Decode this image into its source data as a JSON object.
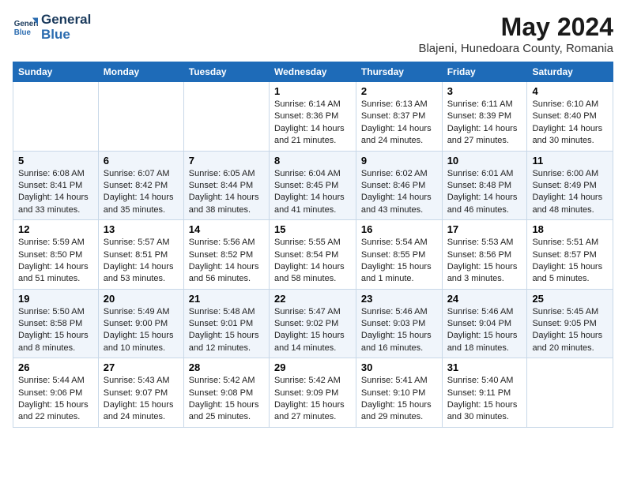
{
  "logo": {
    "line1": "General",
    "line2": "Blue"
  },
  "title": "May 2024",
  "location": "Blajeni, Hunedoara County, Romania",
  "header_days": [
    "Sunday",
    "Monday",
    "Tuesday",
    "Wednesday",
    "Thursday",
    "Friday",
    "Saturday"
  ],
  "weeks": [
    [
      {
        "num": "",
        "info": ""
      },
      {
        "num": "",
        "info": ""
      },
      {
        "num": "",
        "info": ""
      },
      {
        "num": "1",
        "info": "Sunrise: 6:14 AM\nSunset: 8:36 PM\nDaylight: 14 hours and 21 minutes."
      },
      {
        "num": "2",
        "info": "Sunrise: 6:13 AM\nSunset: 8:37 PM\nDaylight: 14 hours and 24 minutes."
      },
      {
        "num": "3",
        "info": "Sunrise: 6:11 AM\nSunset: 8:39 PM\nDaylight: 14 hours and 27 minutes."
      },
      {
        "num": "4",
        "info": "Sunrise: 6:10 AM\nSunset: 8:40 PM\nDaylight: 14 hours and 30 minutes."
      }
    ],
    [
      {
        "num": "5",
        "info": "Sunrise: 6:08 AM\nSunset: 8:41 PM\nDaylight: 14 hours and 33 minutes."
      },
      {
        "num": "6",
        "info": "Sunrise: 6:07 AM\nSunset: 8:42 PM\nDaylight: 14 hours and 35 minutes."
      },
      {
        "num": "7",
        "info": "Sunrise: 6:05 AM\nSunset: 8:44 PM\nDaylight: 14 hours and 38 minutes."
      },
      {
        "num": "8",
        "info": "Sunrise: 6:04 AM\nSunset: 8:45 PM\nDaylight: 14 hours and 41 minutes."
      },
      {
        "num": "9",
        "info": "Sunrise: 6:02 AM\nSunset: 8:46 PM\nDaylight: 14 hours and 43 minutes."
      },
      {
        "num": "10",
        "info": "Sunrise: 6:01 AM\nSunset: 8:48 PM\nDaylight: 14 hours and 46 minutes."
      },
      {
        "num": "11",
        "info": "Sunrise: 6:00 AM\nSunset: 8:49 PM\nDaylight: 14 hours and 48 minutes."
      }
    ],
    [
      {
        "num": "12",
        "info": "Sunrise: 5:59 AM\nSunset: 8:50 PM\nDaylight: 14 hours and 51 minutes."
      },
      {
        "num": "13",
        "info": "Sunrise: 5:57 AM\nSunset: 8:51 PM\nDaylight: 14 hours and 53 minutes."
      },
      {
        "num": "14",
        "info": "Sunrise: 5:56 AM\nSunset: 8:52 PM\nDaylight: 14 hours and 56 minutes."
      },
      {
        "num": "15",
        "info": "Sunrise: 5:55 AM\nSunset: 8:54 PM\nDaylight: 14 hours and 58 minutes."
      },
      {
        "num": "16",
        "info": "Sunrise: 5:54 AM\nSunset: 8:55 PM\nDaylight: 15 hours and 1 minute."
      },
      {
        "num": "17",
        "info": "Sunrise: 5:53 AM\nSunset: 8:56 PM\nDaylight: 15 hours and 3 minutes."
      },
      {
        "num": "18",
        "info": "Sunrise: 5:51 AM\nSunset: 8:57 PM\nDaylight: 15 hours and 5 minutes."
      }
    ],
    [
      {
        "num": "19",
        "info": "Sunrise: 5:50 AM\nSunset: 8:58 PM\nDaylight: 15 hours and 8 minutes."
      },
      {
        "num": "20",
        "info": "Sunrise: 5:49 AM\nSunset: 9:00 PM\nDaylight: 15 hours and 10 minutes."
      },
      {
        "num": "21",
        "info": "Sunrise: 5:48 AM\nSunset: 9:01 PM\nDaylight: 15 hours and 12 minutes."
      },
      {
        "num": "22",
        "info": "Sunrise: 5:47 AM\nSunset: 9:02 PM\nDaylight: 15 hours and 14 minutes."
      },
      {
        "num": "23",
        "info": "Sunrise: 5:46 AM\nSunset: 9:03 PM\nDaylight: 15 hours and 16 minutes."
      },
      {
        "num": "24",
        "info": "Sunrise: 5:46 AM\nSunset: 9:04 PM\nDaylight: 15 hours and 18 minutes."
      },
      {
        "num": "25",
        "info": "Sunrise: 5:45 AM\nSunset: 9:05 PM\nDaylight: 15 hours and 20 minutes."
      }
    ],
    [
      {
        "num": "26",
        "info": "Sunrise: 5:44 AM\nSunset: 9:06 PM\nDaylight: 15 hours and 22 minutes."
      },
      {
        "num": "27",
        "info": "Sunrise: 5:43 AM\nSunset: 9:07 PM\nDaylight: 15 hours and 24 minutes."
      },
      {
        "num": "28",
        "info": "Sunrise: 5:42 AM\nSunset: 9:08 PM\nDaylight: 15 hours and 25 minutes."
      },
      {
        "num": "29",
        "info": "Sunrise: 5:42 AM\nSunset: 9:09 PM\nDaylight: 15 hours and 27 minutes."
      },
      {
        "num": "30",
        "info": "Sunrise: 5:41 AM\nSunset: 9:10 PM\nDaylight: 15 hours and 29 minutes."
      },
      {
        "num": "31",
        "info": "Sunrise: 5:40 AM\nSunset: 9:11 PM\nDaylight: 15 hours and 30 minutes."
      },
      {
        "num": "",
        "info": ""
      }
    ]
  ]
}
